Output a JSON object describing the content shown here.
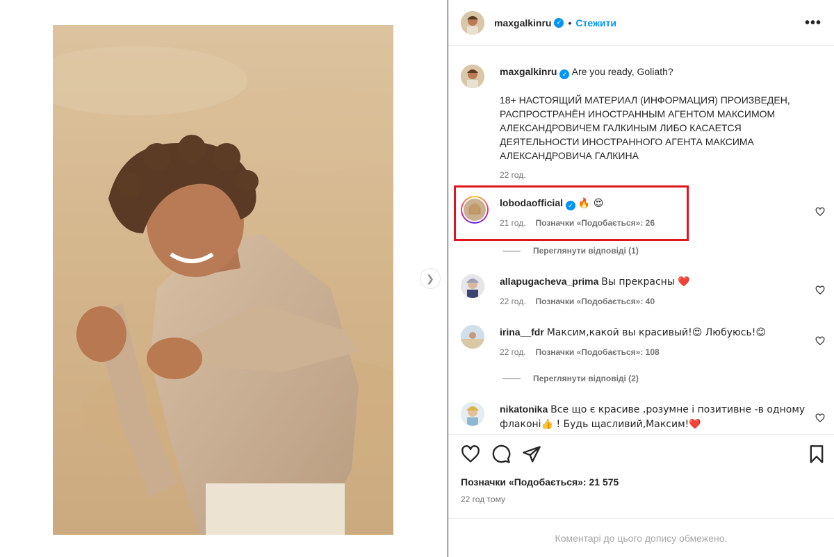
{
  "post": {
    "author": "maxgalkinru",
    "follow_label": "Стежити",
    "separator": "•",
    "more_label": "•••",
    "caption_text": "Are you ready, Goliath?",
    "disclaimer": "18+ НАСТОЯЩИЙ МАТЕРИАЛ (ИНФОРМАЦИЯ) ПРОИЗВЕДЕН, РАСПРОСТРАНЁН ИНОСТРАННЫМ АГЕНТОМ МАКСИМОМ АЛЕКСАНДРОВИЧЕМ ГАЛКИНЫМ ЛИБО КАСАЕТСЯ ДЕЯТЕЛЬНОСТИ ИНОСТРАННОГО АГЕНТА МАКСИМА АЛЕКСАНДРОВИЧА ГАЛКИНА",
    "caption_time": "22 год."
  },
  "comments": [
    {
      "user": "lobodaofficial",
      "text": "🔥 😍",
      "time": "21 год.",
      "likes": "Позначки «Подобається»: 26",
      "highlighted": true
    },
    {
      "user": "allapugacheva_prima",
      "text": "Вы прекрасны ❤️",
      "time": "22 год.",
      "likes": "Позначки «Подобається»: 40"
    },
    {
      "user": "irina__fdr",
      "text": "Максим,какой вы красивый!😍 Любуюсь!😊",
      "time": "22 год.",
      "likes": "Позначки «Подобається»: 108"
    },
    {
      "user": "nikatonika",
      "text": "Все що є красиве ,розумне і позитивне -в одному флаконі👍 ! Будь щасливий,Максим!❤️"
    }
  ],
  "replies": [
    {
      "label": "Переглянути відповіді (1)"
    },
    {
      "label": "Переглянути відповіді (2)"
    }
  ],
  "footer": {
    "likes_total": "Позначки «Подобається»: 21 575",
    "time_ago": "22 год тому",
    "comments_disabled": "Коментарі до цього допису обмежено."
  },
  "icons": {
    "next": "chevron-right-icon",
    "like": "heart-icon",
    "comment": "comment-icon",
    "share": "share-icon",
    "save": "bookmark-icon"
  },
  "colors": {
    "accent": "#0095f6",
    "highlight_box": "#e0141e",
    "muted": "#737373"
  }
}
